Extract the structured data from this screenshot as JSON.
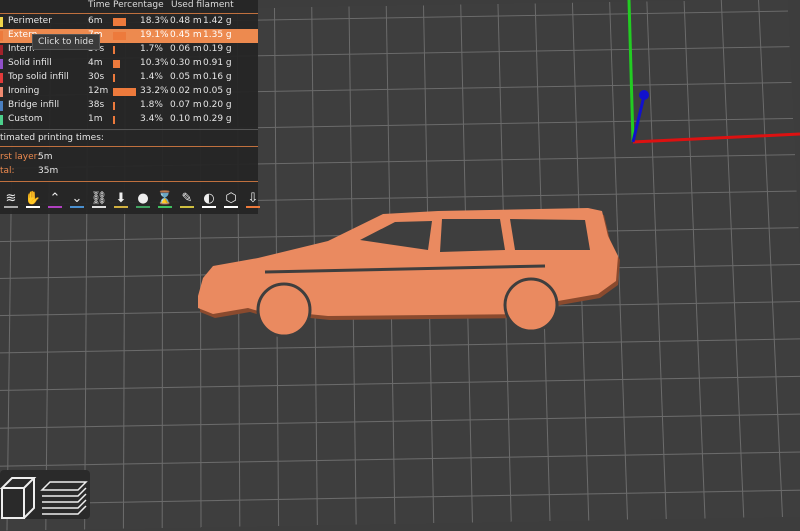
{
  "legend": {
    "headers": {
      "time": "Time",
      "percentage": "Percentage",
      "filament": "Used filament"
    },
    "rows": [
      {
        "label": "Perimeter",
        "time": "6m",
        "pct": "18.3%",
        "pct_value": 18.3,
        "m": "0.48 m",
        "g": "1.42 g",
        "color": "#f0d54a"
      },
      {
        "label": "Extern",
        "time": "7m",
        "pct": "19.1%",
        "pct_value": 19.1,
        "m": "0.45 m",
        "g": "1.35 g",
        "color": "#ed7a3c",
        "highlight": true
      },
      {
        "label": "Intern",
        "time": "37s",
        "pct": "1.7%",
        "pct_value": 1.7,
        "m": "0.06 m",
        "g": "0.19 g",
        "color": "#a3222b"
      },
      {
        "label": "Solid infill",
        "time": "4m",
        "pct": "10.3%",
        "pct_value": 10.3,
        "m": "0.30 m",
        "g": "0.91 g",
        "color": "#9050c8"
      },
      {
        "label": "Top solid infill",
        "time": "30s",
        "pct": "1.4%",
        "pct_value": 1.4,
        "m": "0.05 m",
        "g": "0.16 g",
        "color": "#e23a3a"
      },
      {
        "label": "Ironing",
        "time": "12m",
        "pct": "33.2%",
        "pct_value": 33.2,
        "m": "0.02 m",
        "g": "0.05 g",
        "color": "#f08a70"
      },
      {
        "label": "Bridge infill",
        "time": "38s",
        "pct": "1.8%",
        "pct_value": 1.8,
        "m": "0.07 m",
        "g": "0.20 g",
        "color": "#4a7fc0"
      },
      {
        "label": "Custom",
        "time": "1m",
        "pct": "3.4%",
        "pct_value": 3.4,
        "m": "0.10 m",
        "g": "0.29 g",
        "color": "#4ccf8c"
      }
    ],
    "tooltip": "Click to hide",
    "times_title": "timated printing times:",
    "first_layer_label": "rst layer:",
    "first_layer": "5m",
    "total_label": "tal:",
    "total": "35m"
  },
  "toolbar": [
    {
      "icon": "travel-icon",
      "color": "#aaa"
    },
    {
      "icon": "wipe-icon",
      "color": "#fff"
    },
    {
      "icon": "retractions-icon",
      "color": "#b040c0"
    },
    {
      "icon": "deretractions-icon",
      "color": "#4a90d0"
    },
    {
      "icon": "seams-icon",
      "color": "#ddd"
    },
    {
      "icon": "tool-change-icon",
      "color": "#d0b040"
    },
    {
      "icon": "color-change-icon",
      "color": "#40a060"
    },
    {
      "icon": "pause-icon",
      "color": "#40c060"
    },
    {
      "icon": "custom-gcode-icon",
      "color": "#d0c040"
    },
    {
      "icon": "center-of-gravity-icon",
      "color": "#fff"
    },
    {
      "icon": "shells-icon",
      "color": "#fff"
    },
    {
      "icon": "tool-marker-icon",
      "color": "#ed7a3c"
    }
  ]
}
